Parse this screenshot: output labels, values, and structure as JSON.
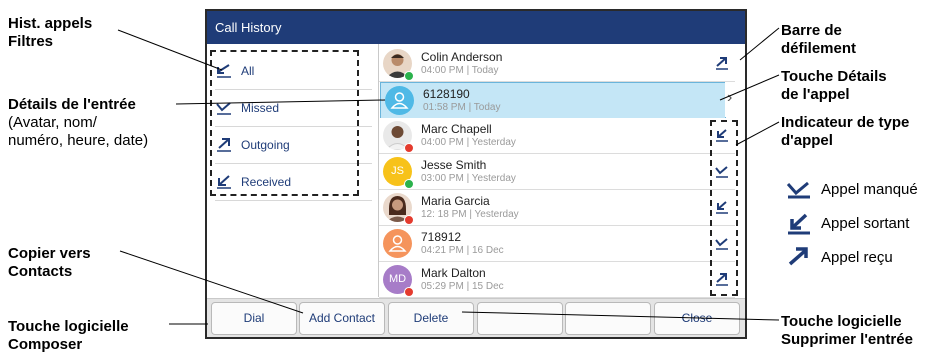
{
  "screen": {
    "title": "Call History",
    "filters": [
      {
        "label": "All",
        "icon": "all-calls-icon"
      },
      {
        "label": "Missed",
        "icon": "missed-call-icon"
      },
      {
        "label": "Outgoing",
        "icon": "outgoing-call-icon"
      },
      {
        "label": "Received",
        "icon": "received-call-icon"
      }
    ],
    "entries": [
      {
        "name": "Colin Anderson",
        "time": "04:00 PM | Today",
        "avatar": "photo",
        "initials": "",
        "avatar_color": "#b98b6a",
        "status": "#2bb24c",
        "call_type": "outgoing"
      },
      {
        "name": "6128190",
        "time": "01:58 PM | Today",
        "avatar": "generic",
        "initials": "",
        "avatar_color": "#4fb9e6",
        "status": "",
        "call_type": "details"
      },
      {
        "name": "Marc Chapell",
        "time": "04:00 PM | Yesterday",
        "avatar": "photo",
        "initials": "",
        "avatar_color": "#6d4a35",
        "status": "#e43b2e",
        "call_type": "received"
      },
      {
        "name": "Jesse Smith",
        "time": "03:00 PM | Yesterday",
        "avatar": "initials",
        "initials": "JS",
        "avatar_color": "#f7c21a",
        "status": "#2bb24c",
        "call_type": "missed"
      },
      {
        "name": "Maria Garcia",
        "time": "12: 18 PM | Yesterday",
        "avatar": "photo",
        "initials": "",
        "avatar_color": "#8c5a45",
        "status": "#e43b2e",
        "call_type": "received"
      },
      {
        "name": "718912",
        "time": "04:21 PM | 16 Dec",
        "avatar": "generic",
        "initials": "",
        "avatar_color": "#f5945c",
        "status": "",
        "call_type": "missed"
      },
      {
        "name": "Mark Dalton",
        "time": "05:29 PM | 15 Dec",
        "avatar": "initials",
        "initials": "MD",
        "avatar_color": "#a77cc8",
        "status": "#e43b2e",
        "call_type": "outgoing"
      }
    ],
    "softkeys": [
      "Dial",
      "Add Contact",
      "Delete",
      "",
      "",
      "Close"
    ]
  },
  "annotations": {
    "hist_filters": [
      "Hist. appels",
      "Filtres"
    ],
    "entry_details_title": "Détails de l'entrée",
    "entry_details_sub": [
      "(Avatar, nom/",
      "numéro, heure, date)"
    ],
    "copy_contacts": [
      "Copier vers",
      "Contacts"
    ],
    "dial_softkey": [
      "Touche logicielle",
      "Composer"
    ],
    "scrollbar": [
      "Barre de",
      "défilement"
    ],
    "details_key": [
      "Touche Détails",
      "de l'appel"
    ],
    "type_indicator": [
      "Indicateur de type",
      "d'appel"
    ],
    "delete_softkey": [
      "Touche logicielle",
      "Supprimer l'entrée"
    ],
    "legend": [
      {
        "label": "Appel manqué",
        "icon": "missed-call-icon"
      },
      {
        "label": "Appel sortant",
        "icon": "outgoing-call-icon"
      },
      {
        "label": "Appel reçu",
        "icon": "received-call-icon"
      }
    ]
  },
  "colors": {
    "title_bar": "#1f3c78",
    "accent": "#1f3c78",
    "selected_row": "#c4e6f6"
  }
}
